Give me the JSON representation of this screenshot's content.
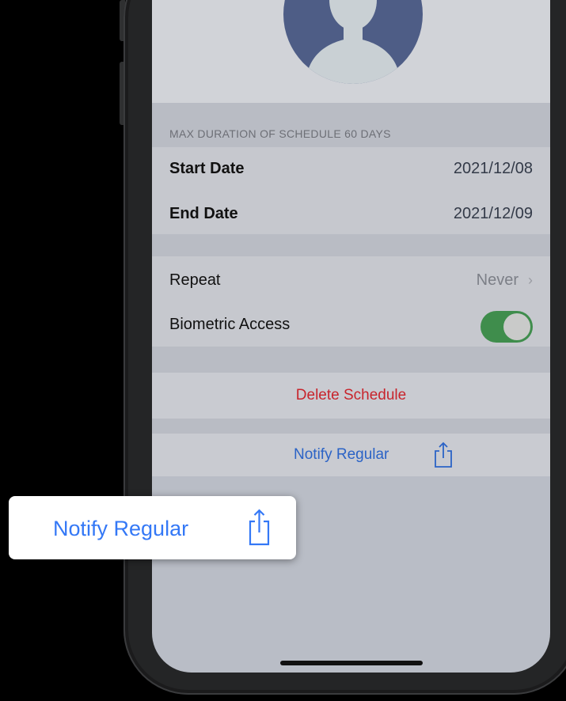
{
  "schedule": {
    "section_header": "MAX DURATION OF SCHEDULE 60 DAYS",
    "start_date_label": "Start Date",
    "start_date_value": "2021/12/08",
    "end_date_label": "End Date",
    "end_date_value": "2021/12/09"
  },
  "options": {
    "repeat_label": "Repeat",
    "repeat_value": "Never",
    "biometric_label": "Biometric Access",
    "biometric_enabled": true
  },
  "actions": {
    "delete_label": "Delete Schedule",
    "notify_label": "Notify Regular"
  },
  "callout": {
    "label": "Notify Regular"
  },
  "colors": {
    "accent_blue": "#3478f6",
    "destructive_red": "#c8242c",
    "toggle_green": "#3f8d4c",
    "avatar_blue": "#4e5d86"
  },
  "icons": {
    "avatar": "person-silhouette-icon",
    "share": "share-icon",
    "chevron": "chevron-right-icon"
  }
}
